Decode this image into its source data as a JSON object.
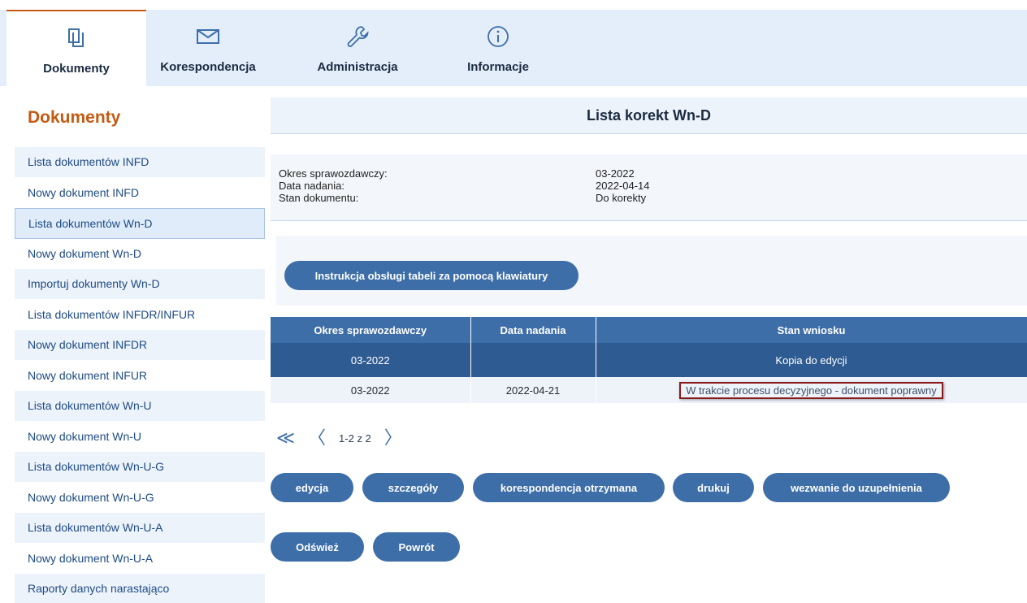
{
  "nav": {
    "tabs": [
      {
        "label": "Dokumenty",
        "icon": "documents-icon",
        "active": true
      },
      {
        "label": "Korespondencja",
        "icon": "envelope-icon",
        "active": false
      },
      {
        "label": "Administracja",
        "icon": "wrench-icon",
        "active": false
      },
      {
        "label": "Informacje",
        "icon": "info-icon",
        "active": false
      }
    ]
  },
  "sidebar": {
    "title": "Dokumenty",
    "items": [
      {
        "label": "Lista dokumentów INFD"
      },
      {
        "label": "Nowy dokument INFD"
      },
      {
        "label": "Lista dokumentów Wn-D",
        "selected": true
      },
      {
        "label": "Nowy dokument Wn-D"
      },
      {
        "label": "Importuj dokumenty Wn-D"
      },
      {
        "label": "Lista dokumentów INFDR/INFUR"
      },
      {
        "label": "Nowy dokument INFDR"
      },
      {
        "label": "Nowy dokument INFUR"
      },
      {
        "label": "Lista dokumentów Wn-U"
      },
      {
        "label": "Nowy dokument Wn-U"
      },
      {
        "label": "Lista dokumentów Wn-U-G"
      },
      {
        "label": "Nowy dokument Wn-U-G"
      },
      {
        "label": "Lista dokumentów Wn-U-A"
      },
      {
        "label": "Nowy dokument Wn-U-A"
      },
      {
        "label": "Raporty danych narastająco"
      }
    ]
  },
  "main": {
    "title": "Lista korekt Wn-D",
    "info": {
      "period_label": "Okres sprawozdawczy:",
      "period_value": "03-2022",
      "sent_label": "Data nadania:",
      "sent_value": "2022-04-14",
      "state_label": "Stan dokumentu:",
      "state_value": "Do korekty"
    },
    "instruction_button": "Instrukcja obsługi tabeli za pomocą klawiatury",
    "table": {
      "headers": [
        "Okres sprawozdawczy",
        "Data nadania",
        "Stan wniosku"
      ],
      "rows": [
        [
          "03-2022",
          "",
          "Kopia do edycji"
        ],
        [
          "03-2022",
          "2022-04-21",
          "W trakcie procesu decyzyjnego - dokument poprawny"
        ]
      ]
    },
    "pagination": {
      "first": "≪",
      "prev": "〈",
      "text": "1-2 z 2",
      "next": "〉"
    },
    "actions": {
      "edit": "edycja",
      "details": "szczegóły",
      "correspondence": "korespondencja otrzymana",
      "print": "drukuj",
      "request": "wezwanie do uzupełnienia",
      "refresh": "Odśwież",
      "back": "Powrót"
    }
  },
  "colors": {
    "accent": "#c45a13",
    "primary": "#3d6ea8",
    "primary_dark": "#2f5b93",
    "nav_bg": "#e3eefa"
  }
}
